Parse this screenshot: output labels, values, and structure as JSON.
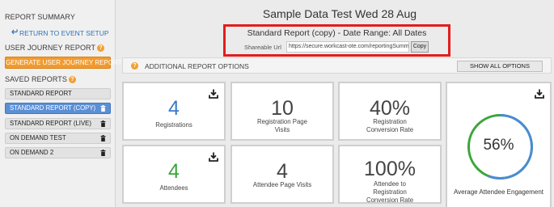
{
  "sidebar": {
    "report_summary": "REPORT SUMMARY",
    "return_link": "RETURN TO EVENT SETUP",
    "user_journey_heading": "USER JOURNEY REPORT",
    "generate_button": "GENERATE USER JOURNEY REPORT",
    "saved_heading": "SAVED REPORTS",
    "reports": [
      {
        "label": "STANDARD REPORT",
        "active": false,
        "deletable": false
      },
      {
        "label": "STANDARD REPORT (COPY)",
        "active": true,
        "deletable": true
      },
      {
        "label": "STANDARD REPORT (LIVE)",
        "active": false,
        "deletable": true
      },
      {
        "label": "ON DEMAND TEST",
        "active": false,
        "deletable": true
      },
      {
        "label": "ON DEMAND 2",
        "active": false,
        "deletable": true
      }
    ]
  },
  "header": {
    "title": "Sample Data Test Wed 28 Aug",
    "subtitle": "Standard Report (copy) - Date Range:  All Dates",
    "share_label": "Shareable Url",
    "share_url": "https://secure.workcast-ote.com/reportingSumm",
    "copy_label": "Copy"
  },
  "options": {
    "label": "ADDITIONAL REPORT OPTIONS",
    "show_all": "SHOW ALL OPTIONS"
  },
  "metrics": [
    {
      "value": "4",
      "label": "Registrations",
      "color": "#3d7cc9",
      "download": true
    },
    {
      "value": "10",
      "label": "Registration Page Visits",
      "color": "#444444",
      "download": false
    },
    {
      "value": "40%",
      "label": "Registration Conversion Rate",
      "color": "#444444",
      "download": false
    },
    {
      "value": "4",
      "label": "Attendees",
      "color": "#3aa63a",
      "download": true
    },
    {
      "value": "4",
      "label": "Attendee Page Visits",
      "color": "#444444",
      "download": false
    },
    {
      "value": "100%",
      "label": "Attendee to Registration Conversion Rate",
      "color": "#444444",
      "download": false
    }
  ],
  "engagement": {
    "value": "56%",
    "fraction": 0.56,
    "label": "Average Attendee Engagement",
    "colors": {
      "primary": "#4a8bd6",
      "secondary": "#3aa63a"
    }
  }
}
